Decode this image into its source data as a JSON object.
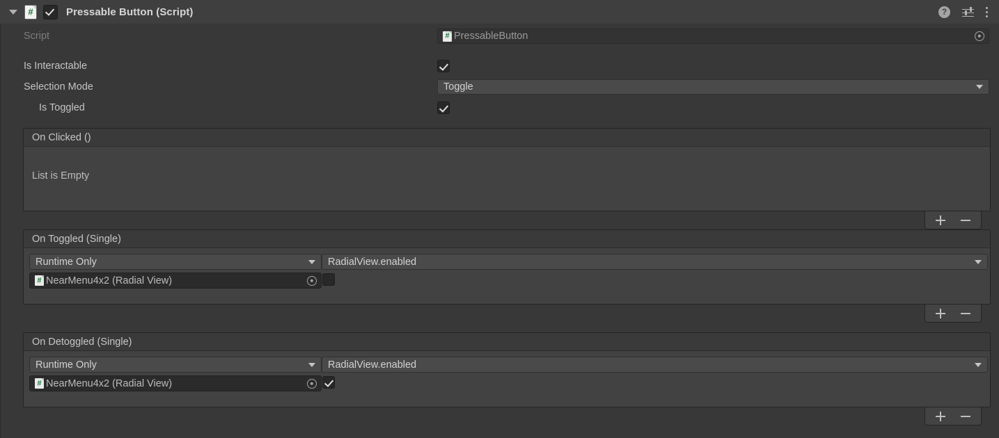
{
  "component": {
    "title": "Pressable Button (Script)",
    "enabled_checkbox": true,
    "foldout_expanded": true,
    "script_icon": "csharp-script-icon",
    "header_icons": {
      "help": "?",
      "preset": "preset-sliders-icon",
      "menu": "kebab-menu-icon"
    }
  },
  "properties": {
    "script": {
      "label": "Script",
      "value": "PressableButton",
      "disabled": true,
      "picker": "object-picker-icon"
    },
    "is_interactable": {
      "label": "Is Interactable",
      "checked": true
    },
    "selection_mode": {
      "label": "Selection Mode",
      "value": "Toggle"
    },
    "is_toggled": {
      "label": "Is Toggled",
      "checked": true
    }
  },
  "events": [
    {
      "header": "On Clicked ()",
      "empty_text": "List is Empty",
      "is_empty": true,
      "listeners": [],
      "footer": {
        "add": "+",
        "remove": "−"
      }
    },
    {
      "header": "On Toggled (Single)",
      "is_empty": false,
      "listeners": [
        {
          "call_state": "Runtime Only",
          "target_object": "NearMenu4x2 (Radial View)",
          "target_icon": "csharp-script-icon",
          "picker": "object-picker-icon",
          "function": "RadialView.enabled",
          "argument_checked": false
        }
      ],
      "footer": {
        "add": "+",
        "remove": "−"
      }
    },
    {
      "header": "On Detoggled (Single)",
      "is_empty": false,
      "listeners": [
        {
          "call_state": "Runtime Only",
          "target_object": "NearMenu4x2 (Radial View)",
          "target_icon": "csharp-script-icon",
          "picker": "object-picker-icon",
          "function": "RadialView.enabled",
          "argument_checked": true
        }
      ],
      "footer": {
        "add": "+",
        "remove": "−"
      }
    }
  ],
  "colors": {
    "background": "#383838",
    "header_bar": "#3f3f3f",
    "field": "#4a4a4a",
    "object_field": "#2b2b2b",
    "event_box": "#424242",
    "event_header": "#3a3a3a",
    "text": "#c4c4c4",
    "script_green": "#1d7a36"
  }
}
